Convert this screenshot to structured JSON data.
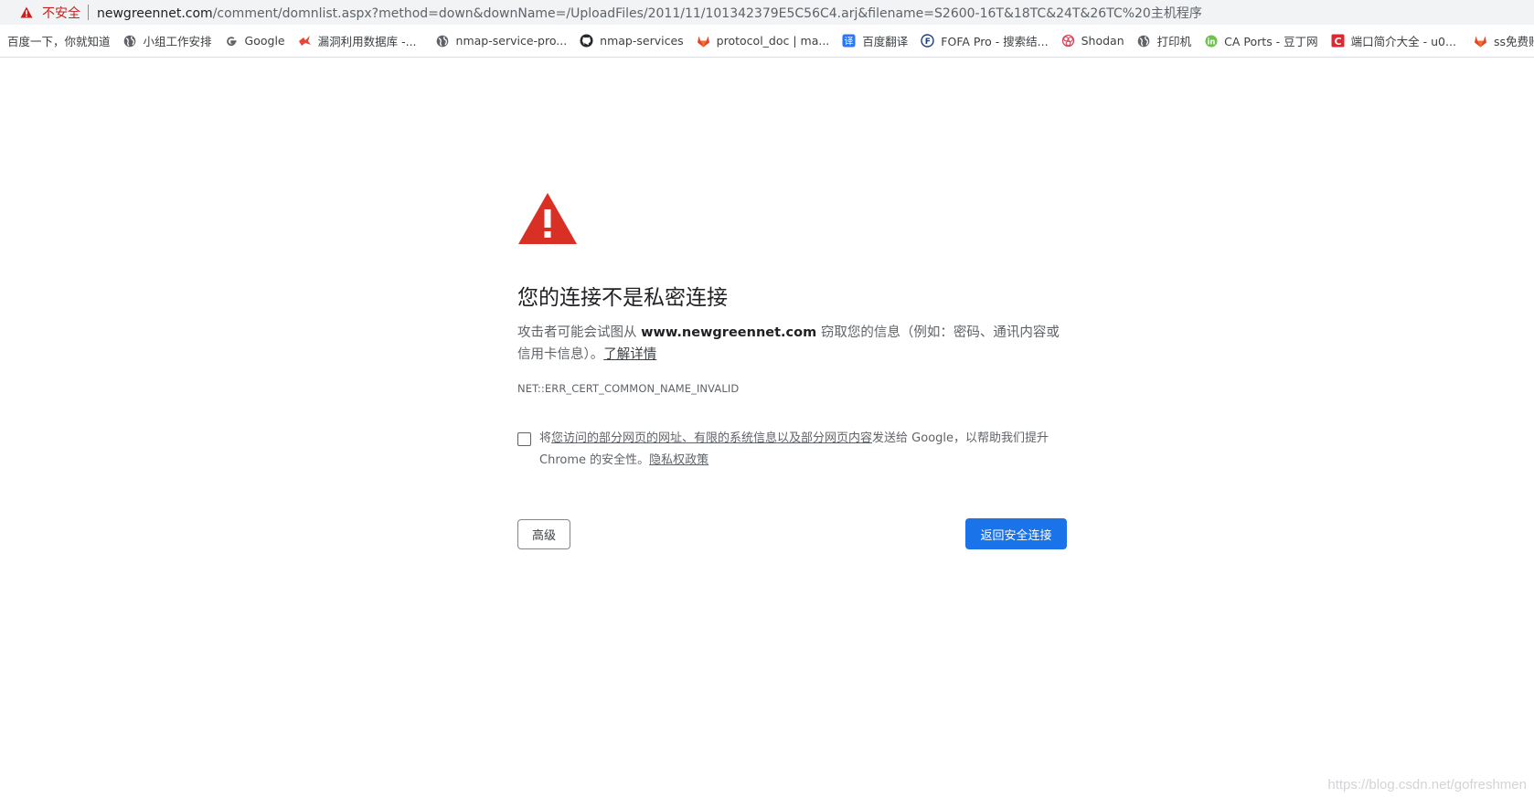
{
  "address_bar": {
    "security_label": "不安全",
    "url_host": "newgreennet.com",
    "url_rest": "/comment/domnlist.aspx?method=down&downName=/UploadFiles/2011/11/101342379E5C56C4.arj&filename=S2600-16T&18TC&24T&26TC%20主机程序"
  },
  "bookmarks": [
    {
      "label": "百度一下，你就知道",
      "icon": "none"
    },
    {
      "label": "小组工作安排",
      "icon": "globe-icon"
    },
    {
      "label": "Google",
      "icon": "google-icon"
    },
    {
      "label": "漏洞利用数据库 -...",
      "icon": "exploitdb-icon"
    },
    {
      "label": "nmap-service-pro...",
      "icon": "globe-icon"
    },
    {
      "label": "nmap-services",
      "icon": "github-icon"
    },
    {
      "label": "protocol_doc | ma...",
      "icon": "gitlab-icon"
    },
    {
      "label": "百度翻译",
      "icon": "baidu-translate-icon"
    },
    {
      "label": "FOFA Pro - 搜索结...",
      "icon": "fofa-icon"
    },
    {
      "label": "Shodan",
      "icon": "shodan-icon"
    },
    {
      "label": "打印机",
      "icon": "globe-icon"
    },
    {
      "label": "CA Ports - 豆丁网",
      "icon": "docin-icon"
    },
    {
      "label": "端口简介大全 - u0...",
      "icon": "csdn-icon"
    },
    {
      "label": "ss免费账-",
      "icon": "gitlab-icon"
    }
  ],
  "interstitial": {
    "title": "您的连接不是私密连接",
    "desc_prefix": "攻击者可能会试图从 ",
    "desc_host": "www.newgreennet.com",
    "desc_suffix": " 窃取您的信息（例如：密码、通讯内容或信用卡信息）。",
    "learn_more": "了解详情",
    "error_code": "NET::ERR_CERT_COMMON_NAME_INVALID",
    "optin_prefix": "将",
    "optin_link": "您访问的部分网页的网址、有限的系统信息以及部分网页内容",
    "optin_suffix": "发送给 Google，以帮助我们提升 Chrome 的安全性。",
    "privacy_link": "隐私权政策",
    "advanced_button": "高级",
    "back_button": "返回安全连接"
  },
  "watermark": "https://blog.csdn.net/gofreshmen",
  "colors": {
    "danger": "#d93025",
    "primary": "#1a73e8",
    "insecure_text": "#c5221f"
  }
}
